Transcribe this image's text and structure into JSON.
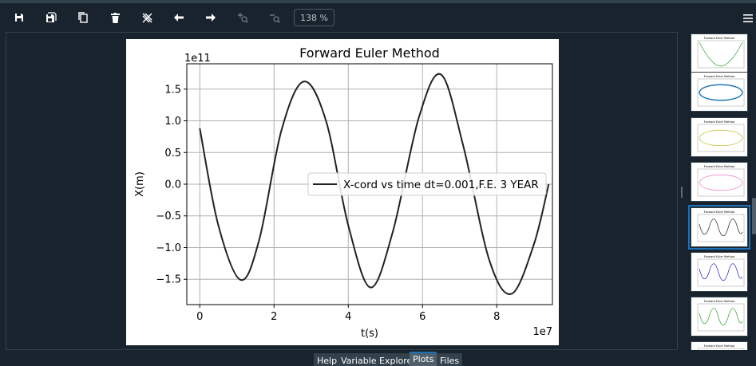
{
  "toolbar": {
    "zoom_label": "138 %",
    "buttons": [
      {
        "name": "save-icon"
      },
      {
        "name": "save-all-icon"
      },
      {
        "name": "copy-icon"
      },
      {
        "name": "trash-icon"
      },
      {
        "name": "close-all-icon"
      },
      {
        "name": "arrow-left-icon"
      },
      {
        "name": "arrow-right-icon"
      },
      {
        "name": "zoom-in-icon"
      },
      {
        "name": "zoom-out-icon"
      }
    ]
  },
  "tabs": [
    {
      "label": "Help"
    },
    {
      "label": "Variable Explorer"
    },
    {
      "label": "Plots",
      "active": true
    },
    {
      "label": "Files"
    }
  ],
  "colors": {
    "background": "#19232d",
    "accent": "#1a72bb",
    "tab": "#32414b",
    "curve": "#000000"
  },
  "chart_data": {
    "type": "line",
    "title": "Forward Euler Method",
    "xlabel": "t(s)",
    "ylabel": "X(m)",
    "x_offset_label": "1e7",
    "y_offset_label": "1e11",
    "xlim": [
      -0.35,
      9.5
    ],
    "ylim": [
      -1.9,
      1.9
    ],
    "xticks": [
      0,
      2,
      4,
      6,
      8
    ],
    "xtick_labels": [
      "0",
      "2",
      "4",
      "6",
      "8"
    ],
    "yticks": [
      -1.5,
      -1.0,
      -0.5,
      0.0,
      0.5,
      1.0,
      1.5
    ],
    "ytick_labels": [
      "−1.5",
      "−1.0",
      "−0.5",
      "0.0",
      "0.5",
      "1.0",
      "1.5"
    ],
    "grid": true,
    "legend_position": "center-right",
    "series": [
      {
        "name": "X-cord vs time dt=0.001,F.E. 3 YEAR",
        "color": "#222222",
        "x": [
          0,
          0.5,
          1.1,
          1.6,
          2.2,
          2.8,
          3.4,
          4.0,
          4.6,
          5.2,
          5.9,
          6.5,
          7.1,
          7.8,
          8.4,
          9.0,
          9.4
        ],
        "y": [
          0.88,
          -0.65,
          -1.51,
          -0.88,
          0.85,
          1.62,
          1.0,
          -0.65,
          -1.63,
          -0.75,
          1.05,
          1.73,
          0.6,
          -1.2,
          -1.73,
          -0.95,
          0.0
        ]
      }
    ]
  },
  "thumbnails": [
    {
      "title": "Forward Euler Method",
      "color": "#2ca02c"
    },
    {
      "title": "Forward Euler Method",
      "color": "#1f77b4"
    },
    {
      "title": "Forward Euler Method",
      "color": "#bcbd22"
    },
    {
      "title": "Forward Euler Method",
      "color": "#e377c2"
    },
    {
      "title": "Forward Euler Method",
      "color": "#222222",
      "selected": true
    },
    {
      "title": "Forward Euler Method",
      "color": "#1f1fd0"
    },
    {
      "title": "Forward Euler Method",
      "color": "#2ca02c"
    },
    {
      "title": "Forward Euler Method",
      "color": "#1f77b4"
    }
  ]
}
